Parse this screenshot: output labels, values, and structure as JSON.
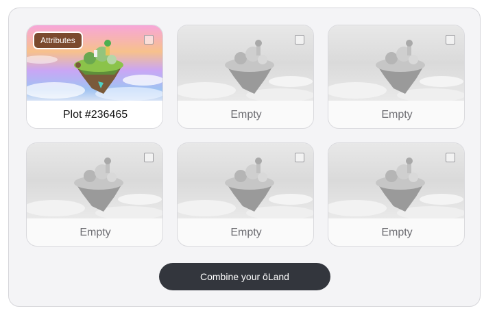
{
  "plots": [
    {
      "label": "Plot #236465",
      "filled": true,
      "badge": "Attributes",
      "image": "floating-island-colorful"
    },
    {
      "label": "Empty",
      "filled": false,
      "image": "floating-island-grayscale"
    },
    {
      "label": "Empty",
      "filled": false,
      "image": "floating-island-grayscale"
    },
    {
      "label": "Empty",
      "filled": false,
      "image": "floating-island-grayscale"
    },
    {
      "label": "Empty",
      "filled": false,
      "image": "floating-island-grayscale"
    },
    {
      "label": "Empty",
      "filled": false,
      "image": "floating-island-grayscale"
    }
  ],
  "combine_button": {
    "label": "Combine your ōLand"
  },
  "colors": {
    "button_bg": "#33363d",
    "badge_bg": "#7b4a2e",
    "panel_bg": "#f4f4f6"
  }
}
